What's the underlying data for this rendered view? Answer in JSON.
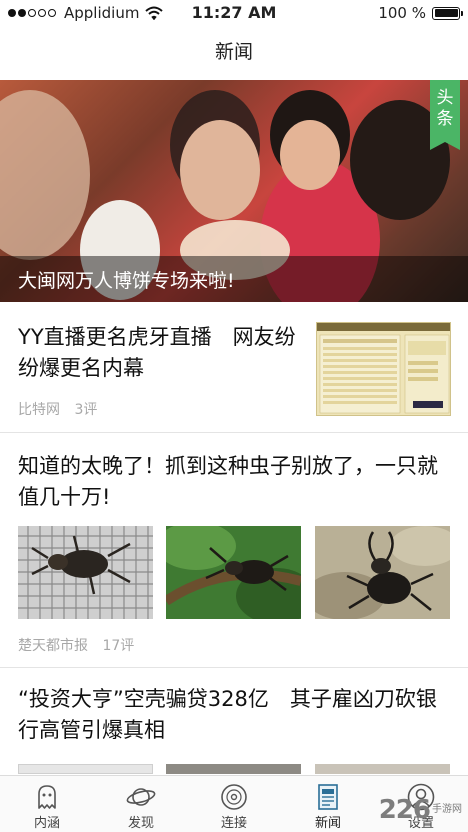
{
  "status_bar": {
    "carrier": "Applidium",
    "time": "11:27 AM",
    "battery": "100 %",
    "signal_dots_filled": 2,
    "signal_dots_total": 5
  },
  "nav": {
    "title": "新闻"
  },
  "hero": {
    "caption": "大闽网万人博饼专场来啦!",
    "tag_line1": "头",
    "tag_line2": "条",
    "tag_color": "#4bb566"
  },
  "articles": [
    {
      "title": "YY直播更名虎牙直播　网友纷纷爆更名内幕",
      "source": "比特网",
      "comments": "3评"
    },
    {
      "title": "知道的太晚了！抓到这种虫子别放了，一只就值几十万!",
      "source": "楚天都市报",
      "comments": "17评"
    },
    {
      "title": "“投资大亨”空壳骗贷328亿　其子雇凶刀砍银行高管引爆真相"
    }
  ],
  "tabs": [
    {
      "label": "内涵",
      "icon": "ghost-icon"
    },
    {
      "label": "发现",
      "icon": "planet-icon"
    },
    {
      "label": "连接",
      "icon": "disc-icon"
    },
    {
      "label": "新闻",
      "icon": "newspaper-icon"
    },
    {
      "label": "设置",
      "icon": "person-icon"
    }
  ],
  "watermark": {
    "number": "226",
    "site": "手游网"
  },
  "colors": {
    "accent": "#4bb566",
    "meta_text": "#a8a8a8"
  }
}
